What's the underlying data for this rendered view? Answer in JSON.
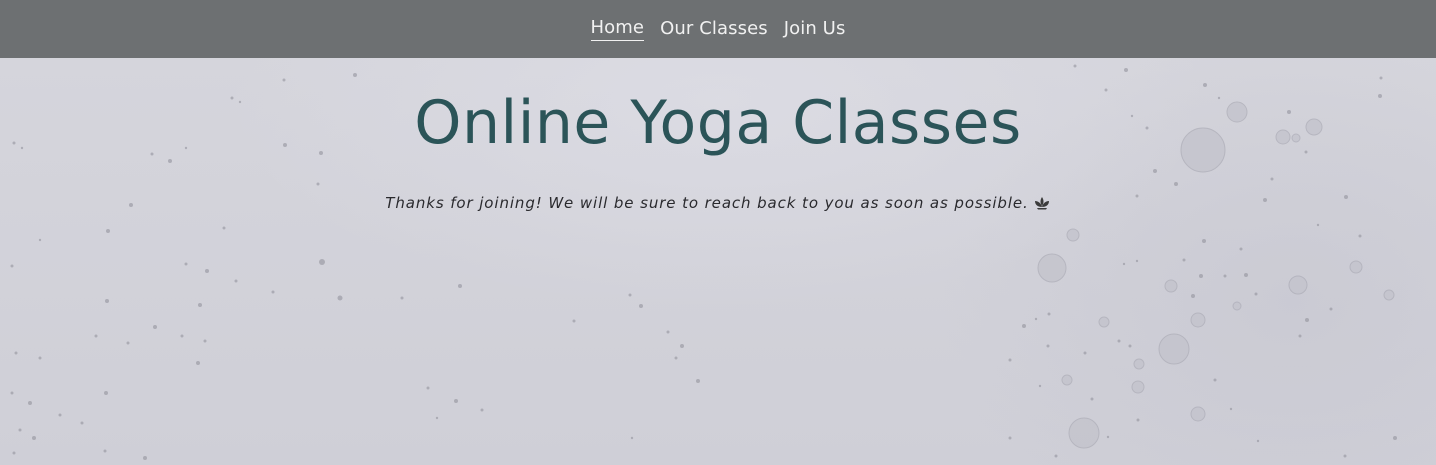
{
  "nav": {
    "items": [
      {
        "label": "Home",
        "active": true
      },
      {
        "label": "Our Classes",
        "active": false
      },
      {
        "label": "Join Us",
        "active": false
      }
    ]
  },
  "hero": {
    "title": "Online Yoga Classes",
    "message": "Thanks for joining! We will be sure to reach back to you as soon as possible.",
    "message_icon": "lotus-icon"
  },
  "colors": {
    "nav_background": "#6d7072",
    "nav_text": "#f1f1f1",
    "title": "#2b5458",
    "message_text": "#2a2a2e"
  }
}
